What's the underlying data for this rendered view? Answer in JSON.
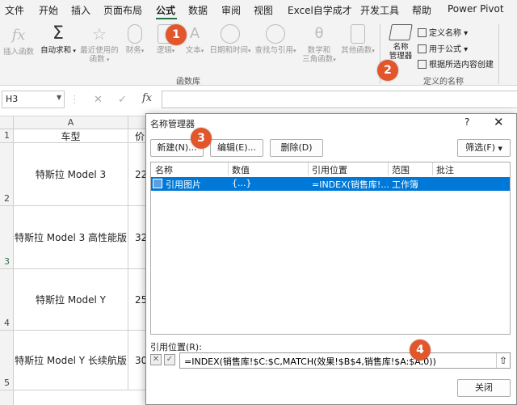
{
  "menu": {
    "tabs": [
      "文件",
      "开始",
      "插入",
      "页面布局",
      "公式",
      "数据",
      "审阅",
      "视图",
      "Excel自学成才",
      "开发工具",
      "帮助",
      "Power Pivot"
    ],
    "active": "公式"
  },
  "ribbon": {
    "insert_function": "插入函数",
    "autosum": "自动求和",
    "recent": "最近使用的",
    "recent2": "函数",
    "financial": "财务",
    "logical": "逻辑",
    "text": "文本",
    "datetime": "日期和时间",
    "lookup": "查找与引用",
    "math": "数学和",
    "math2": "三角函数",
    "other": "其他函数",
    "group_library": "函数库",
    "name_manager": "名称",
    "name_manager2": "管理器",
    "define_name": "定义名称",
    "use_in_formula": "用于公式",
    "create_from_selection": "根据所选内容创建",
    "group_defined": "定义的名称"
  },
  "formula_bar": {
    "name_box": "H3",
    "fx": "fx",
    "cancel": "✕",
    "enter": "✓"
  },
  "sheet": {
    "columns": [
      "A"
    ],
    "header_row": {
      "a": "车型",
      "b": "价"
    },
    "rows": [
      {
        "num": "1"
      },
      {
        "num": "2",
        "a": "特斯拉 Model 3",
        "b": "22"
      },
      {
        "num": "3",
        "a": "特斯拉 Model 3 高性能版",
        "b": "32"
      },
      {
        "num": "4",
        "a": "特斯拉 Model Y",
        "b": "25"
      },
      {
        "num": "5",
        "a": "特斯拉 Model Y 长续航版",
        "b": "30"
      }
    ]
  },
  "dialog": {
    "title": "名称管理器",
    "help": "?",
    "close": "✕",
    "new": "新建(N)...",
    "edit": "编辑(E)...",
    "delete": "删除(D)",
    "filter": "筛选(F)",
    "columns": [
      "名称",
      "数值",
      "引用位置",
      "范围",
      "批注"
    ],
    "entry": {
      "name": "引用图片",
      "value": "{...}",
      "refers": "=INDEX(销售库!...",
      "scope": "工作簿",
      "comment": ""
    },
    "refers_label": "引用位置(R):",
    "refers_value": "=INDEX(销售库!$C:$C,MATCH(效果!$B$4,销售库!$A:$A,0))",
    "close_button": "关闭"
  },
  "badges": [
    "1",
    "2",
    "3",
    "4"
  ],
  "colors": {
    "accent": "#217346",
    "badge": "#e2562c",
    "selection": "#0078d7"
  }
}
